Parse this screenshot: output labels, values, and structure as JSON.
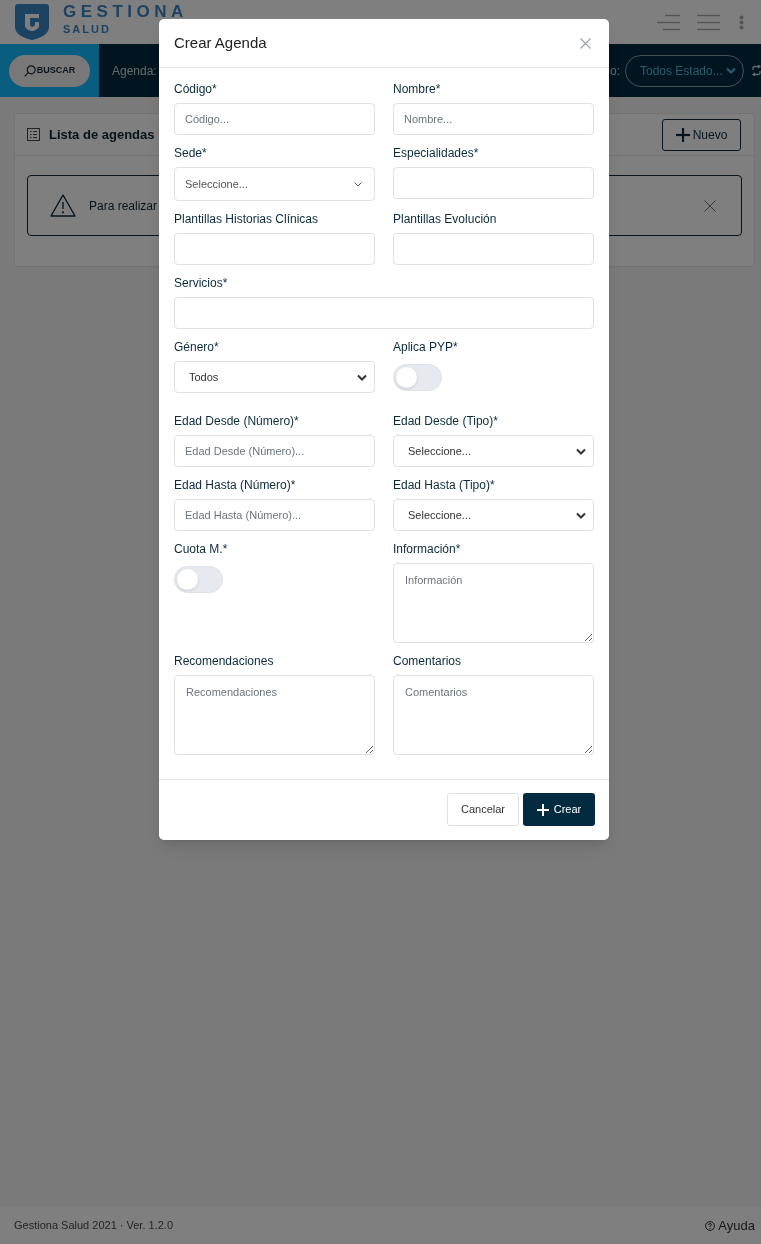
{
  "header": {
    "logo_title": "GESTIONA",
    "logo_subtitle": "SALUD"
  },
  "toolbar": {
    "search_button": "BUSCAR",
    "agenda_label": "Agenda:",
    "status_label": "o:",
    "status_filter": "Todos Estado..."
  },
  "card": {
    "title": "Lista de agendas",
    "new_button": "Nuevo",
    "alert": {
      "text": "Para realizar"
    }
  },
  "modal": {
    "title": "Crear Agenda",
    "fields": [
      {
        "kind": "input",
        "label": "Código*",
        "placeholder": "Código..."
      },
      {
        "kind": "input",
        "label": "Nombre*",
        "placeholder": "Nombre..."
      },
      {
        "kind": "picker",
        "label": "Sede*",
        "placeholder": "Seleccione..."
      },
      {
        "kind": "input",
        "label": "Especialidades*"
      },
      {
        "kind": "input",
        "label": "Plantillas Historias Clínicas"
      },
      {
        "kind": "input",
        "label": "Plantillas Evolución"
      },
      {
        "kind": "input",
        "label": "Servicios*",
        "wide": true
      },
      {
        "kind": "select",
        "label": "Género*",
        "value": "Todos"
      },
      {
        "kind": "toggle",
        "label": "Aplica PYP*",
        "on": false
      },
      {
        "kind": "input",
        "label": "Edad Desde (Número)*",
        "placeholder": "Edad Desde (Número)..."
      },
      {
        "kind": "select",
        "label": "Edad Desde (Tipo)*",
        "value": "Seleccione..."
      },
      {
        "kind": "input",
        "label": "Edad Hasta (Número)*",
        "placeholder": "Edad Hasta (Número)..."
      },
      {
        "kind": "select",
        "label": "Edad Hasta (Tipo)*",
        "value": "Seleccione..."
      },
      {
        "kind": "toggle",
        "label": "Cuota M.*",
        "on": false
      },
      {
        "kind": "textarea",
        "label": "Información*",
        "placeholder": "Información"
      },
      {
        "kind": "textarea",
        "label": "Recomendaciones",
        "placeholder": "Recomendaciones"
      },
      {
        "kind": "textarea",
        "label": "Comentarios",
        "placeholder": "Comentarios"
      }
    ],
    "buttons": [
      {
        "label": "Cancelar",
        "kind": "secondary"
      },
      {
        "label": "Crear",
        "kind": "primary"
      }
    ]
  },
  "footer": {
    "version": "Gestiona Salud 2021 · Ver. 1.2.0",
    "help_link": "Ayuda"
  }
}
